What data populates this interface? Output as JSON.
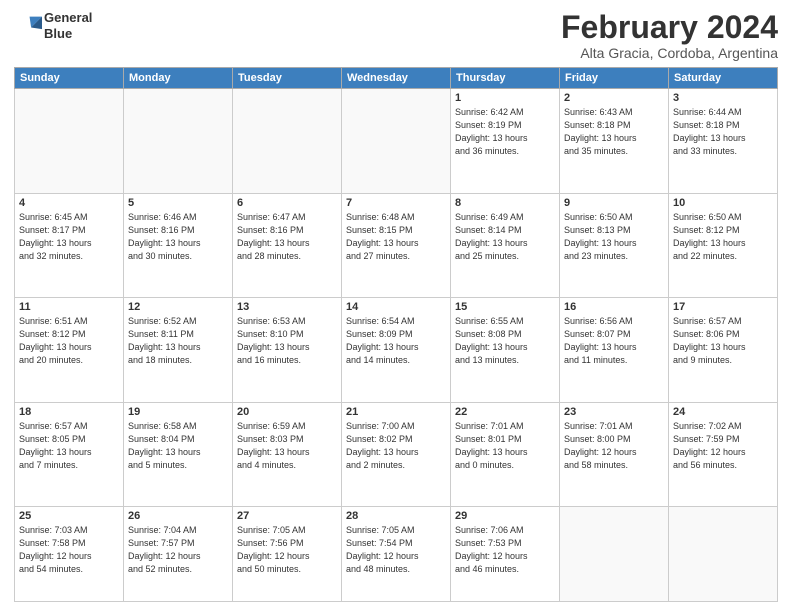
{
  "logo": {
    "line1": "General",
    "line2": "Blue"
  },
  "title": "February 2024",
  "location": "Alta Gracia, Cordoba, Argentina",
  "weekdays": [
    "Sunday",
    "Monday",
    "Tuesday",
    "Wednesday",
    "Thursday",
    "Friday",
    "Saturday"
  ],
  "rows": [
    [
      {
        "day": "",
        "info": ""
      },
      {
        "day": "",
        "info": ""
      },
      {
        "day": "",
        "info": ""
      },
      {
        "day": "",
        "info": ""
      },
      {
        "day": "1",
        "info": "Sunrise: 6:42 AM\nSunset: 8:19 PM\nDaylight: 13 hours\nand 36 minutes."
      },
      {
        "day": "2",
        "info": "Sunrise: 6:43 AM\nSunset: 8:18 PM\nDaylight: 13 hours\nand 35 minutes."
      },
      {
        "day": "3",
        "info": "Sunrise: 6:44 AM\nSunset: 8:18 PM\nDaylight: 13 hours\nand 33 minutes."
      }
    ],
    [
      {
        "day": "4",
        "info": "Sunrise: 6:45 AM\nSunset: 8:17 PM\nDaylight: 13 hours\nand 32 minutes."
      },
      {
        "day": "5",
        "info": "Sunrise: 6:46 AM\nSunset: 8:16 PM\nDaylight: 13 hours\nand 30 minutes."
      },
      {
        "day": "6",
        "info": "Sunrise: 6:47 AM\nSunset: 8:16 PM\nDaylight: 13 hours\nand 28 minutes."
      },
      {
        "day": "7",
        "info": "Sunrise: 6:48 AM\nSunset: 8:15 PM\nDaylight: 13 hours\nand 27 minutes."
      },
      {
        "day": "8",
        "info": "Sunrise: 6:49 AM\nSunset: 8:14 PM\nDaylight: 13 hours\nand 25 minutes."
      },
      {
        "day": "9",
        "info": "Sunrise: 6:50 AM\nSunset: 8:13 PM\nDaylight: 13 hours\nand 23 minutes."
      },
      {
        "day": "10",
        "info": "Sunrise: 6:50 AM\nSunset: 8:12 PM\nDaylight: 13 hours\nand 22 minutes."
      }
    ],
    [
      {
        "day": "11",
        "info": "Sunrise: 6:51 AM\nSunset: 8:12 PM\nDaylight: 13 hours\nand 20 minutes."
      },
      {
        "day": "12",
        "info": "Sunrise: 6:52 AM\nSunset: 8:11 PM\nDaylight: 13 hours\nand 18 minutes."
      },
      {
        "day": "13",
        "info": "Sunrise: 6:53 AM\nSunset: 8:10 PM\nDaylight: 13 hours\nand 16 minutes."
      },
      {
        "day": "14",
        "info": "Sunrise: 6:54 AM\nSunset: 8:09 PM\nDaylight: 13 hours\nand 14 minutes."
      },
      {
        "day": "15",
        "info": "Sunrise: 6:55 AM\nSunset: 8:08 PM\nDaylight: 13 hours\nand 13 minutes."
      },
      {
        "day": "16",
        "info": "Sunrise: 6:56 AM\nSunset: 8:07 PM\nDaylight: 13 hours\nand 11 minutes."
      },
      {
        "day": "17",
        "info": "Sunrise: 6:57 AM\nSunset: 8:06 PM\nDaylight: 13 hours\nand 9 minutes."
      }
    ],
    [
      {
        "day": "18",
        "info": "Sunrise: 6:57 AM\nSunset: 8:05 PM\nDaylight: 13 hours\nand 7 minutes."
      },
      {
        "day": "19",
        "info": "Sunrise: 6:58 AM\nSunset: 8:04 PM\nDaylight: 13 hours\nand 5 minutes."
      },
      {
        "day": "20",
        "info": "Sunrise: 6:59 AM\nSunset: 8:03 PM\nDaylight: 13 hours\nand 4 minutes."
      },
      {
        "day": "21",
        "info": "Sunrise: 7:00 AM\nSunset: 8:02 PM\nDaylight: 13 hours\nand 2 minutes."
      },
      {
        "day": "22",
        "info": "Sunrise: 7:01 AM\nSunset: 8:01 PM\nDaylight: 13 hours\nand 0 minutes."
      },
      {
        "day": "23",
        "info": "Sunrise: 7:01 AM\nSunset: 8:00 PM\nDaylight: 12 hours\nand 58 minutes."
      },
      {
        "day": "24",
        "info": "Sunrise: 7:02 AM\nSunset: 7:59 PM\nDaylight: 12 hours\nand 56 minutes."
      }
    ],
    [
      {
        "day": "25",
        "info": "Sunrise: 7:03 AM\nSunset: 7:58 PM\nDaylight: 12 hours\nand 54 minutes."
      },
      {
        "day": "26",
        "info": "Sunrise: 7:04 AM\nSunset: 7:57 PM\nDaylight: 12 hours\nand 52 minutes."
      },
      {
        "day": "27",
        "info": "Sunrise: 7:05 AM\nSunset: 7:56 PM\nDaylight: 12 hours\nand 50 minutes."
      },
      {
        "day": "28",
        "info": "Sunrise: 7:05 AM\nSunset: 7:54 PM\nDaylight: 12 hours\nand 48 minutes."
      },
      {
        "day": "29",
        "info": "Sunrise: 7:06 AM\nSunset: 7:53 PM\nDaylight: 12 hours\nand 46 minutes."
      },
      {
        "day": "",
        "info": ""
      },
      {
        "day": "",
        "info": ""
      }
    ]
  ]
}
